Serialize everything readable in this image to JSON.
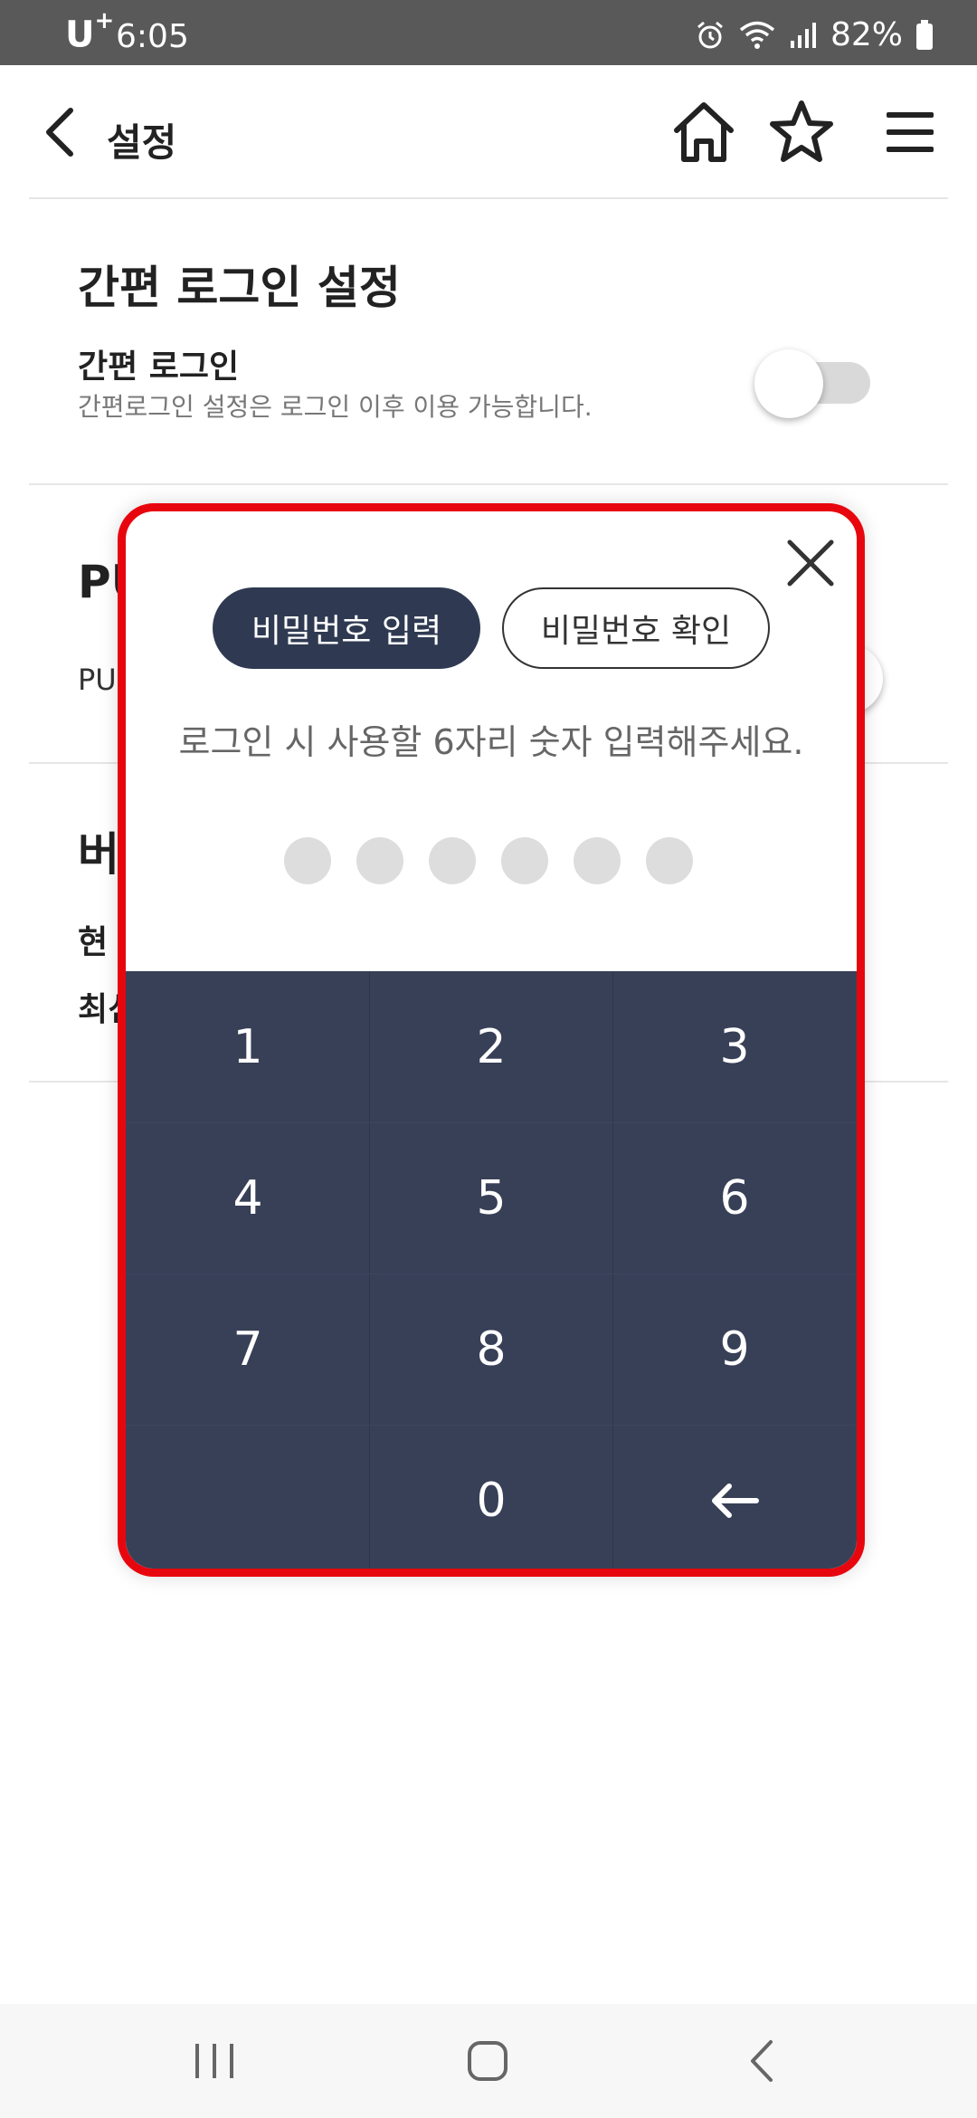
{
  "status_bar": {
    "carrier": "U",
    "carrier_mark": "+",
    "time": "6:05",
    "battery": "82%"
  },
  "header": {
    "title": "설정"
  },
  "simple_login": {
    "section_title": "간편 로그인 설정",
    "label": "간편 로그인",
    "description": "간편로그인 설정은 로그인 이후 이용 가능합니다.",
    "toggle_on": false
  },
  "push_section": {
    "title_partial": "PU",
    "label_partial": "PU"
  },
  "version_section": {
    "title_partial": "버",
    "row1_partial": "현",
    "row2_partial": "최신"
  },
  "modal": {
    "tab_input": "비밀번호 입력",
    "tab_confirm": "비밀번호 확인",
    "instruction": "로그인 시 사용할 6자리 숫자 입력해주세요.",
    "pin_length": 6,
    "keys": [
      "1",
      "2",
      "3",
      "4",
      "5",
      "6",
      "7",
      "8",
      "9",
      "",
      "0",
      "←"
    ]
  },
  "colors": {
    "accent": "#2f3a52",
    "keypad": "#384057",
    "highlight_border": "#e8060e",
    "status_bar": "#595959"
  }
}
